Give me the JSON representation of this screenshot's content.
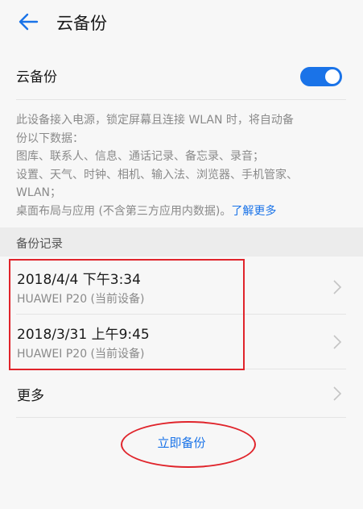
{
  "header": {
    "title": "云备份",
    "back_icon": "arrow-left-icon"
  },
  "toggle": {
    "label": "云备份",
    "on": true
  },
  "description": {
    "lines": [
      "此设备接入电源，锁定屏幕且连接 WLAN 时，将自动备",
      "份以下数据：",
      "图库、联系人、信息、通话记录、备忘录、录音；",
      "设置、天气、时钟、相机、输入法、浏览器、手机管家、",
      "WLAN；"
    ],
    "last_line": "桌面布局与应用 (不含第三方应用内数据)。",
    "learn_more": "了解更多"
  },
  "section": {
    "title": "备份记录"
  },
  "records": [
    {
      "date": "2018/4/4 下午3:34",
      "device": "HUAWEI P20 (当前设备)"
    },
    {
      "date": "2018/3/31 上午9:45",
      "device": "HUAWEI P20 (当前设备)"
    }
  ],
  "more": {
    "label": "更多"
  },
  "backup_now": {
    "label": "立即备份"
  },
  "colors": {
    "accent": "#1a73e8",
    "annotation": "#e0242b"
  }
}
